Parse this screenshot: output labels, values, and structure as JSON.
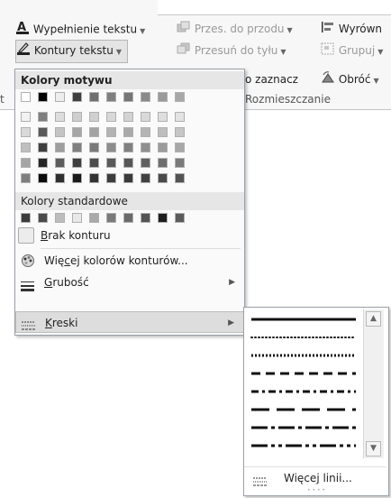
{
  "ribbon": {
    "fill_text": "Wypełnienie tekstu",
    "outline_text": "Kontury tekstu",
    "bring_forward": "Przes. do przodu",
    "send_backward": "Przesuń do tyłu",
    "align": "Wyrówn",
    "group": "Grupuj",
    "select_fragment": "o zaznacz",
    "rotate": "Obróć",
    "group_label": "Rozmieszczanie",
    "left_fragment": "t"
  },
  "menu": {
    "theme_colors_header": "Kolory motywu",
    "standard_colors_header": "Kolory standardowe",
    "no_outline_prefix": "B",
    "no_outline_rest": "rak konturu",
    "more_colors_pre": "Wię",
    "more_colors_ul": "c",
    "more_colors_post": "ej kolorów konturów...",
    "weight_ul": "G",
    "weight_rest": "rubość",
    "dashes_ul": "K",
    "dashes_rest": "reski"
  },
  "colors": {
    "theme_top": [
      "#ffffff",
      "#000000",
      "#eeeeee",
      "#3f3f3f",
      "#6f6f6f",
      "#7f7f7f",
      "#767676",
      "#8a8a8a",
      "#9a9a9a",
      "#a8a8a8"
    ],
    "theme_shades": [
      [
        "#f2f2f2",
        "#7f7f7f",
        "#dddddd",
        "#cfcfcf",
        "#d0d0d0",
        "#d8d8d8",
        "#d3d3d3",
        "#d9d9d9",
        "#dedede",
        "#e3e3e3"
      ],
      [
        "#d9d9d9",
        "#595959",
        "#c4c4c4",
        "#a6a6a6",
        "#a3a3a3",
        "#b3b3b3",
        "#aaaaaa",
        "#b5b5b5",
        "#bdbdbd",
        "#c6c6c6"
      ],
      [
        "#bfbfbf",
        "#3f3f3f",
        "#9e9e9e",
        "#7f7f7f",
        "#7a7a7a",
        "#8d8d8d",
        "#818181",
        "#8f8f8f",
        "#9b9b9b",
        "#a8a8a8"
      ],
      [
        "#a5a5a5",
        "#262626",
        "#5d5d5d",
        "#3f3f3f",
        "#4d4d4d",
        "#595959",
        "#575757",
        "#616161",
        "#6e6e6e",
        "#7a7a7a"
      ],
      [
        "#7f7f7f",
        "#0c0c0c",
        "#2f2f2f",
        "#1a1a1a",
        "#333333",
        "#3d3d3d",
        "#3a3a3a",
        "#424242",
        "#4a4a4a",
        "#525252"
      ]
    ],
    "standard": [
      "#3c3c3c",
      "#4a4a4a",
      "#bdbdbd",
      "#e8e8e8",
      "#a9a9a9",
      "#7a7a7a",
      "#6b6b6b",
      "#535353",
      "#1f1f1f",
      "#5b5b5b"
    ]
  },
  "submenu": {
    "more_lines_pre": "Więce",
    "more_lines_ul": "j",
    "more_lines_post": " linii...",
    "dash_styles": [
      "solid",
      "round-dot",
      "square-dot",
      "dash",
      "dash-dot",
      "long-dash",
      "long-dash-dot",
      "long-dash-dot-dot"
    ]
  }
}
